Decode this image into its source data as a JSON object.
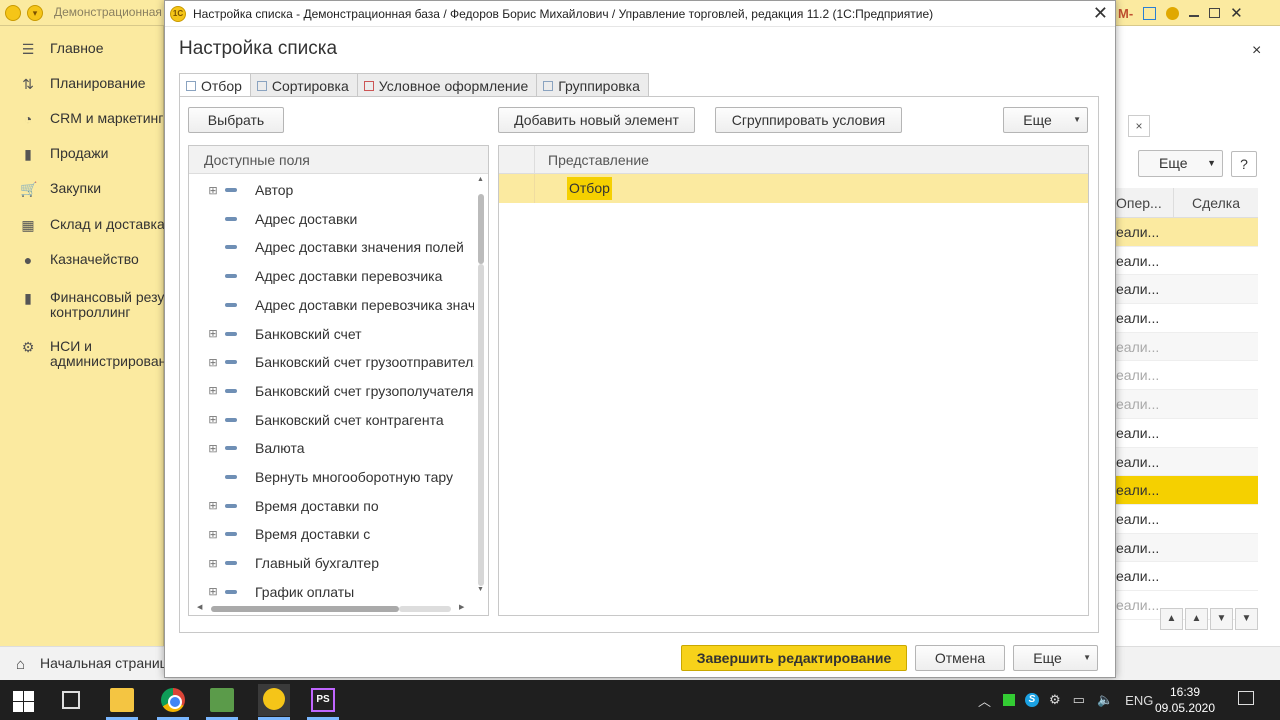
{
  "background": {
    "title": "Демонстрационная б",
    "close_symbol": "×",
    "sidebar": [
      {
        "icon": "menu-icon",
        "label": "Главное"
      },
      {
        "icon": "planning-icon",
        "label": "Планирование"
      },
      {
        "icon": "crm-icon",
        "label": "CRM и маркетинг"
      },
      {
        "icon": "sales-icon",
        "label": "Продажи"
      },
      {
        "icon": "cart-icon",
        "label": "Закупки"
      },
      {
        "icon": "warehouse-icon",
        "label": "Склад и доставка"
      },
      {
        "icon": "treasury-icon",
        "label": "Казначейство"
      },
      {
        "icon": "chart-icon",
        "label": "Финансовый резул\nконтроллинг"
      },
      {
        "icon": "gear-icon",
        "label": "НСИ и\nадминистрировани"
      }
    ],
    "home_label": "Начальная страница",
    "more_label": "Еще",
    "help_label": "?",
    "table": {
      "headers": [
        "Опер...",
        "Сделка"
      ],
      "rows": [
        {
          "c1": "еали...",
          "state": "hl"
        },
        {
          "c1": "еали...",
          "state": ""
        },
        {
          "c1": "еали...",
          "state": "alt"
        },
        {
          "c1": "еали...",
          "state": ""
        },
        {
          "c1": "еали...",
          "state": "alt dim"
        },
        {
          "c1": "еали...",
          "state": "dim"
        },
        {
          "c1": "еали...",
          "state": "alt dim"
        },
        {
          "c1": "еали...",
          "state": ""
        },
        {
          "c1": "еали...",
          "state": "alt"
        },
        {
          "c1": "еали...",
          "state": "sel"
        },
        {
          "c1": "еали...",
          "state": ""
        },
        {
          "c1": "еали...",
          "state": "alt"
        },
        {
          "c1": "еали...",
          "state": ""
        },
        {
          "c1": "еали...",
          "state": "dim"
        }
      ]
    }
  },
  "dialog": {
    "window_title": "Настройка списка - Демонстрационная база / Федоров Борис Михайлович / Управление торговлей, редакция 11.2  (1С:Предприятие)",
    "heading": "Настройка списка",
    "tabs": [
      {
        "label": "Отбор",
        "active": true
      },
      {
        "label": "Сортировка",
        "active": false
      },
      {
        "label": "Условное оформление",
        "active": false
      },
      {
        "label": "Группировка",
        "active": false
      }
    ],
    "toolbar": {
      "select": "Выбрать",
      "add_new": "Добавить новый элемент",
      "group_conditions": "Сгруппировать условия",
      "more": "Еще"
    },
    "fields_header": "Доступные поля",
    "fields": [
      {
        "label": "Автор",
        "expandable": true
      },
      {
        "label": "Адрес доставки",
        "expandable": false
      },
      {
        "label": "Адрес доставки значения полей",
        "expandable": false
      },
      {
        "label": "Адрес доставки перевозчика",
        "expandable": false
      },
      {
        "label": "Адрес доставки перевозчика значен",
        "expandable": false
      },
      {
        "label": "Банковский счет",
        "expandable": true
      },
      {
        "label": "Банковский счет грузоотправителя",
        "expandable": true
      },
      {
        "label": "Банковский счет грузополучателя",
        "expandable": true
      },
      {
        "label": "Банковский счет контрагента",
        "expandable": true
      },
      {
        "label": "Валюта",
        "expandable": true
      },
      {
        "label": "Вернуть многооборотную тару",
        "expandable": false
      },
      {
        "label": "Время доставки по",
        "expandable": true
      },
      {
        "label": "Время доставки с",
        "expandable": true
      },
      {
        "label": "Главный бухгалтер",
        "expandable": true
      },
      {
        "label": "График оплаты",
        "expandable": true
      }
    ],
    "filters_header": "Представление",
    "filter_rows": [
      "Отбор"
    ],
    "footer": {
      "finish": "Завершить редактирование",
      "cancel": "Отмена",
      "more": "Еще"
    }
  },
  "taskbar": {
    "lang": "ENG",
    "time": "16:39",
    "date": "09.05.2020"
  }
}
